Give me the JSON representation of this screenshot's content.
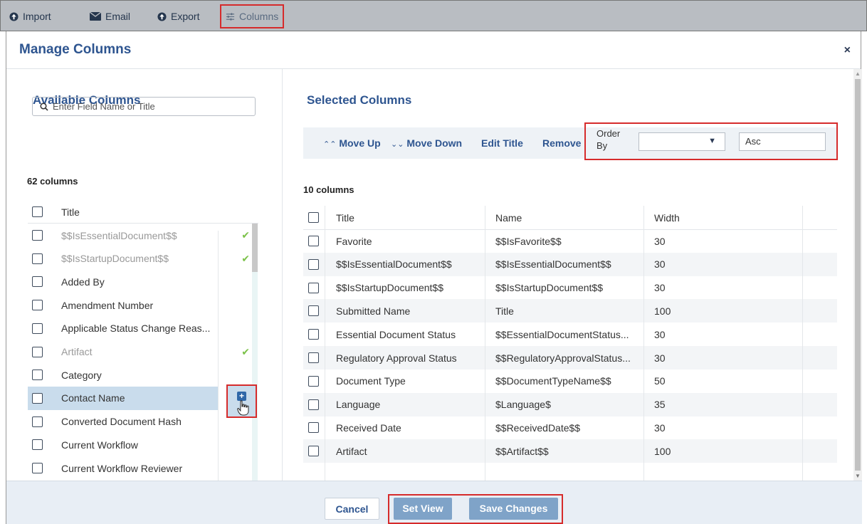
{
  "toolbar": {
    "import_label": "Import",
    "email_label": "Email",
    "export_label": "Export",
    "columns_label": "Columns"
  },
  "modal": {
    "title": "Manage Columns",
    "close_icon": "×"
  },
  "available": {
    "title": "Available Columns",
    "search_placeholder": "Enter Field Name or Title",
    "count": "62 columns",
    "header_title": "Title",
    "rows": [
      {
        "label": "$$IsEssentialDocument$$",
        "dim": true,
        "check": true
      },
      {
        "label": "$$IsStartupDocument$$",
        "dim": true,
        "check": true
      },
      {
        "label": "Added By",
        "dim": false,
        "check": false
      },
      {
        "label": "Amendment Number",
        "dim": false,
        "check": false
      },
      {
        "label": "Applicable Status Change Reas...",
        "dim": false,
        "check": false
      },
      {
        "label": "Artifact",
        "dim": true,
        "check": true
      },
      {
        "label": "Category",
        "dim": false,
        "check": false
      },
      {
        "label": "Contact Name",
        "dim": false,
        "check": false
      },
      {
        "label": "Converted Document Hash",
        "dim": false,
        "check": false
      },
      {
        "label": "Current Workflow",
        "dim": false,
        "check": false
      },
      {
        "label": "Current Workflow Reviewer",
        "dim": false,
        "check": false
      }
    ]
  },
  "selected": {
    "title": "Selected Columns",
    "move_up": "Move Up",
    "move_down": "Move Down",
    "edit_title": "Edit Title",
    "remove": "Remove",
    "order_by_label": "Order By",
    "order_by_value": "",
    "direction": "Asc",
    "count": "10 columns",
    "headers": {
      "title": "Title",
      "name": "Name",
      "width": "Width"
    },
    "rows": [
      {
        "title": "Favorite",
        "name": "$$IsFavorite$$",
        "width": "30"
      },
      {
        "title": "$$IsEssentialDocument$$",
        "name": "$$IsEssentialDocument$$",
        "width": "30"
      },
      {
        "title": "$$IsStartupDocument$$",
        "name": "$$IsStartupDocument$$",
        "width": "30"
      },
      {
        "title": "Submitted Name",
        "name": "Title",
        "width": "100"
      },
      {
        "title": "Essential Document Status",
        "name": "$$EssentialDocumentStatus...",
        "width": "30"
      },
      {
        "title": "Regulatory Approval Status",
        "name": "$$RegulatoryApprovalStatus...",
        "width": "30"
      },
      {
        "title": "Document Type",
        "name": "$$DocumentTypeName$$",
        "width": "50"
      },
      {
        "title": "Language",
        "name": "$Language$",
        "width": "35"
      },
      {
        "title": "Received Date",
        "name": "$$ReceivedDate$$",
        "width": "30"
      },
      {
        "title": "Artifact",
        "name": "$$Artifact$$",
        "width": "100"
      }
    ]
  },
  "footer": {
    "cancel": "Cancel",
    "set_view": "Set View",
    "save_changes": "Save Changes"
  },
  "colors": {
    "accent": "#2e5590",
    "highlight_box": "#d62b2b",
    "selected_row": "#c9dcec",
    "check_green": "#7cc24a"
  }
}
